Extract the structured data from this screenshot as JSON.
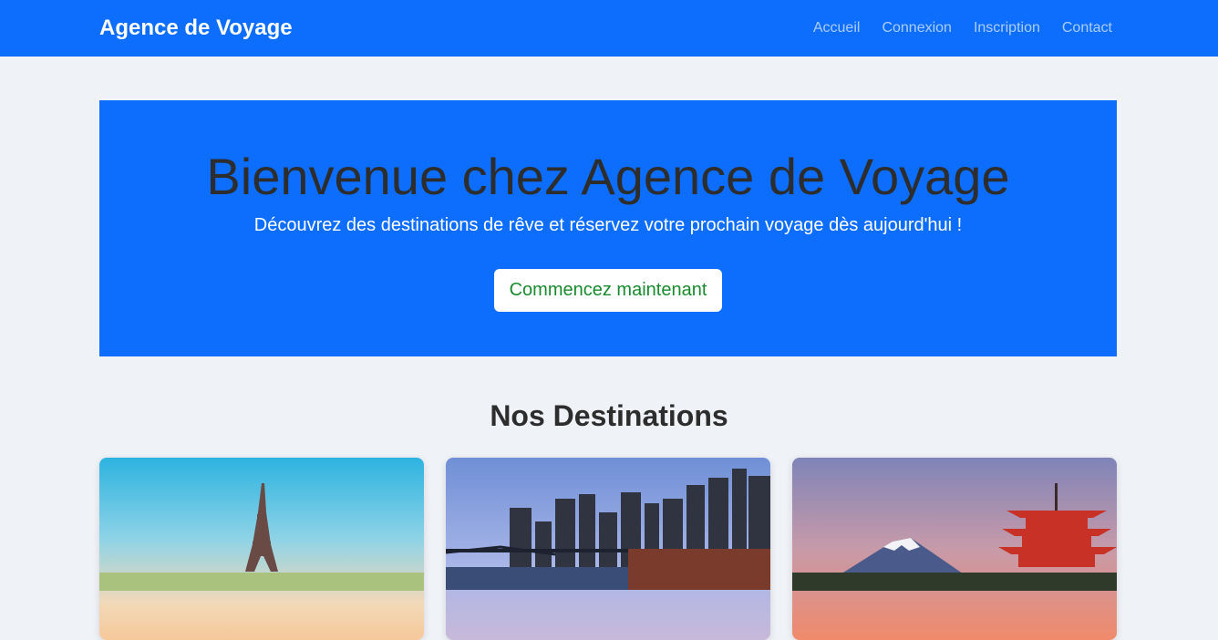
{
  "navbar": {
    "brand": "Agence de Voyage",
    "links": [
      "Accueil",
      "Connexion",
      "Inscription",
      "Contact"
    ]
  },
  "hero": {
    "title": "Bienvenue chez Agence de Voyage",
    "subtitle": "Découvrez des destinations de rêve et réservez votre prochain voyage dès aujourd'hui !",
    "cta_label": "Commencez maintenant"
  },
  "destinations": {
    "title": "Nos Destinations"
  },
  "colors": {
    "primary": "#0d6efd",
    "cta_text": "#198a2e",
    "background": "#eff2f7"
  }
}
